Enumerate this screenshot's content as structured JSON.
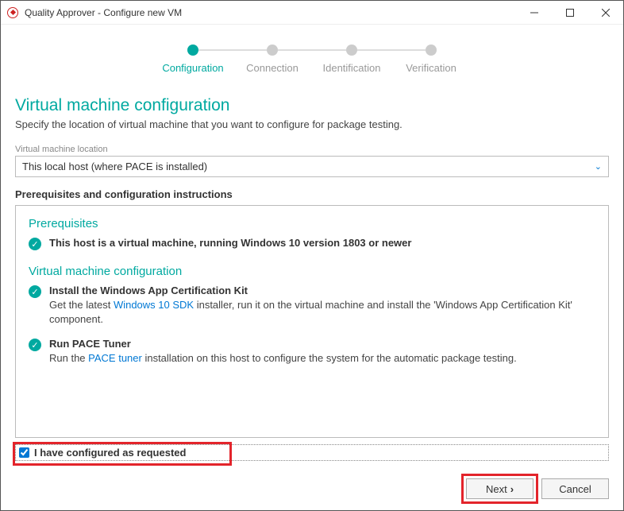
{
  "window": {
    "title": "Quality Approver - Configure new VM"
  },
  "stepper": {
    "steps": [
      {
        "label": "Configuration",
        "active": true
      },
      {
        "label": "Connection",
        "active": false
      },
      {
        "label": "Identification",
        "active": false
      },
      {
        "label": "Verification",
        "active": false
      }
    ]
  },
  "page": {
    "heading": "Virtual machine configuration",
    "sub": "Specify the location of virtual machine that you want to configure for package testing."
  },
  "location": {
    "label": "Virtual machine location",
    "value": "This local host (where PACE is installed)"
  },
  "instructions": {
    "section_label": "Prerequisites and configuration instructions",
    "prereq_heading": "Prerequisites",
    "prereq_item": {
      "title": "This host is a virtual machine, running Windows 10 version 1803 or newer"
    },
    "vmconfig_heading": "Virtual machine configuration",
    "item1": {
      "title": "Install the Windows App Certification Kit",
      "desc_pre": "Get the latest ",
      "desc_link": "Windows 10 SDK",
      "desc_post": " installer, run it on the virtual machine and install the 'Windows App Certification Kit' component."
    },
    "item2": {
      "title": "Run PACE Tuner",
      "desc_pre": "Run the ",
      "desc_link": "PACE tuner",
      "desc_post": " installation on this host to configure the system for the automatic package testing."
    }
  },
  "confirm": {
    "label": "I have configured as requested"
  },
  "actions": {
    "next": "Next",
    "cancel": "Cancel"
  }
}
